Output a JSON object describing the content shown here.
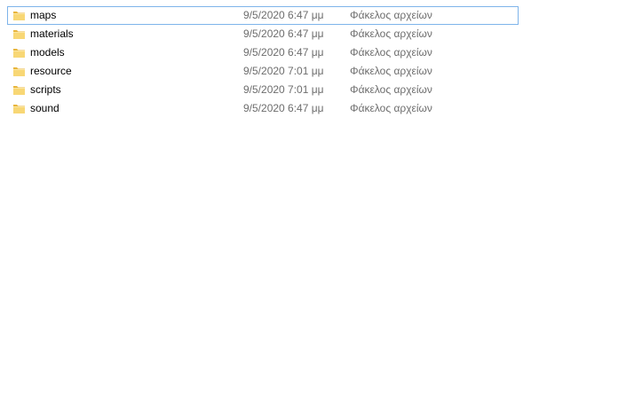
{
  "folders": [
    {
      "name": "maps",
      "date": "9/5/2020 6:47 μμ",
      "type": "Φάκελος αρχείων",
      "focused": true
    },
    {
      "name": "materials",
      "date": "9/5/2020 6:47 μμ",
      "type": "Φάκελος αρχείων"
    },
    {
      "name": "models",
      "date": "9/5/2020 6:47 μμ",
      "type": "Φάκελος αρχείων"
    },
    {
      "name": "resource",
      "date": "9/5/2020 7:01 μμ",
      "type": "Φάκελος αρχείων"
    },
    {
      "name": "scripts",
      "date": "9/5/2020 7:01 μμ",
      "type": "Φάκελος αρχείων"
    },
    {
      "name": "sound",
      "date": "9/5/2020 6:47 μμ",
      "type": "Φάκελος αρχείων"
    }
  ],
  "icons": {
    "folder": "folder-icon"
  },
  "colors": {
    "focus_border": "#7eb4ea",
    "secondary_text": "#6d6d6d",
    "folder_yellow": "#f3c84a"
  }
}
